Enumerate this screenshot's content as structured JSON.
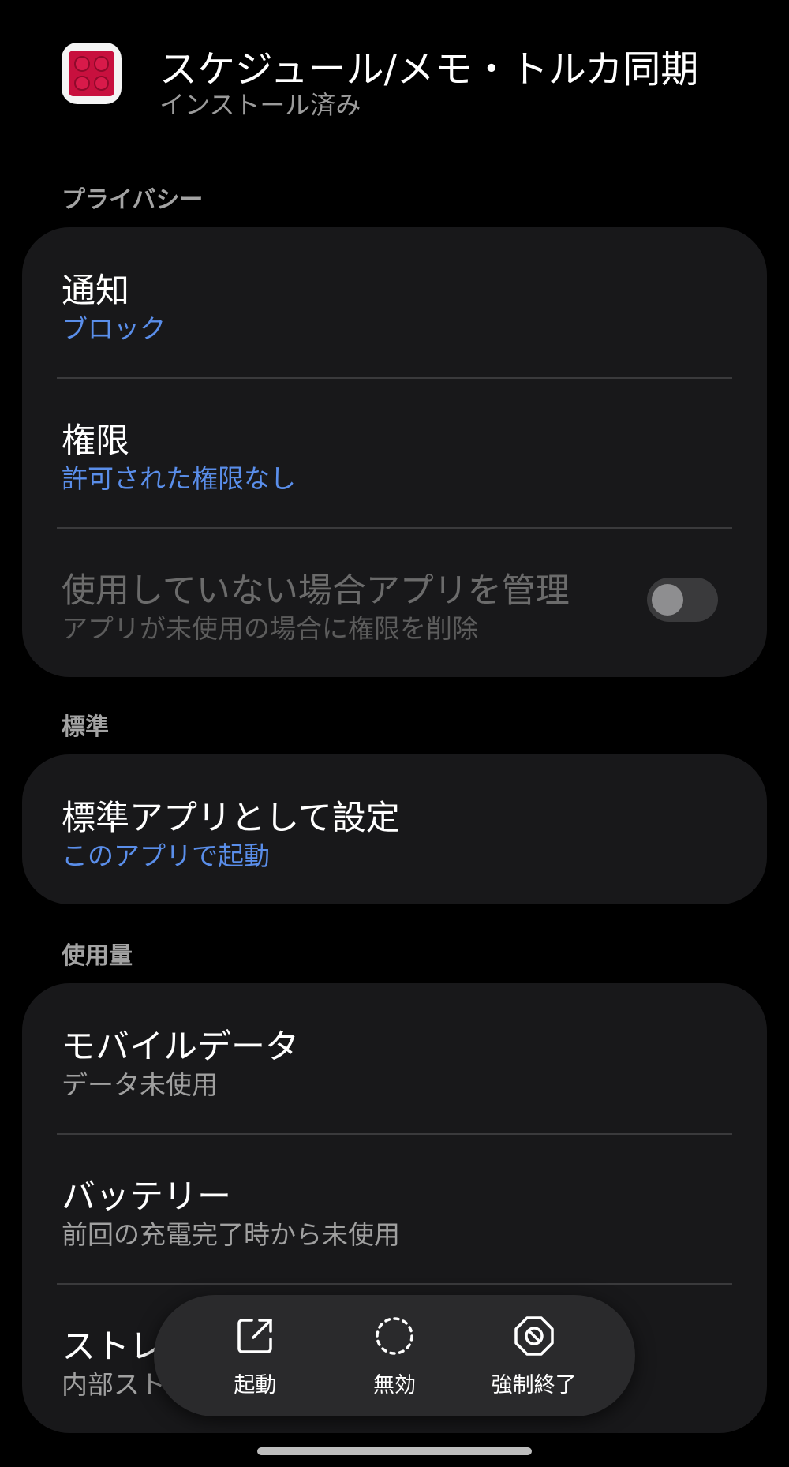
{
  "app": {
    "title": "スケジュール/メモ・トルカ同期",
    "status": "インストール済み",
    "icon": "app-grid-icon",
    "icon_color": "#c8103e"
  },
  "sections": {
    "privacy": {
      "label": "プライバシー",
      "notifications": {
        "title": "通知",
        "value": "ブロック"
      },
      "permissions": {
        "title": "権限",
        "value": "許可された権限なし"
      },
      "manage_unused": {
        "title": "使用していない場合アプリを管理",
        "description": "アプリが未使用の場合に権限を削除",
        "enabled": false
      }
    },
    "default": {
      "label": "標準",
      "set_default": {
        "title": "標準アプリとして設定",
        "value": "このアプリで起動"
      }
    },
    "usage": {
      "label": "使用量",
      "mobile_data": {
        "title": "モバイルデータ",
        "value": "データ未使用"
      },
      "battery": {
        "title": "バッテリー",
        "value": "前回の充電完了時から未使用"
      },
      "storage": {
        "title": "ストレ",
        "value": "内部スト"
      }
    }
  },
  "actions": {
    "open": {
      "label": "起動",
      "icon": "open-external-icon"
    },
    "disable": {
      "label": "無効",
      "icon": "disable-dashed-circle-icon"
    },
    "force_stop": {
      "label": "強制終了",
      "icon": "force-stop-icon"
    }
  },
  "colors": {
    "background": "#000000",
    "card": "#18181a",
    "accent_blue": "#5a8eea"
  }
}
